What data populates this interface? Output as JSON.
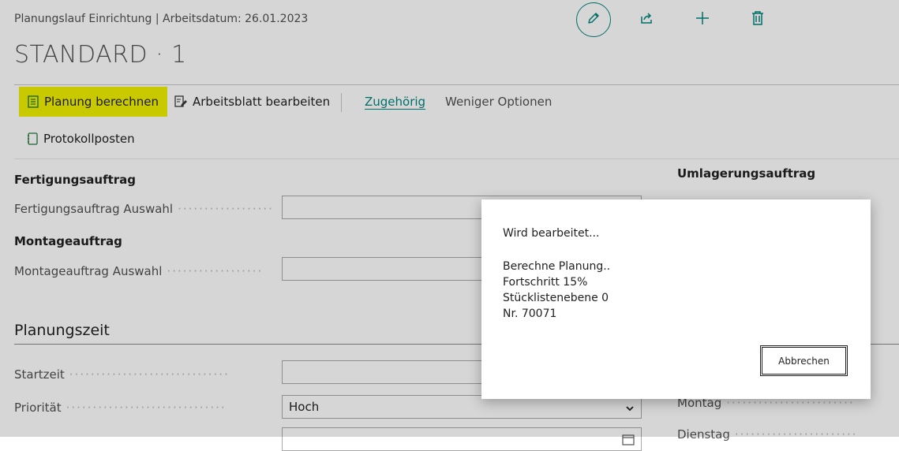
{
  "header": {
    "breadcrumb": "Planungslauf Einrichtung | Arbeitsdatum: 26.01.2023",
    "title": "STANDARD · 1",
    "icons": [
      "edit-icon",
      "share-icon",
      "add-icon",
      "delete-icon"
    ],
    "accent_color": "#00857e"
  },
  "actions": {
    "planung_berechnen": "Planung berechnen",
    "arbeitsblatt_bearbeiten": "Arbeitsblatt bearbeiten",
    "zugehoerig": "Zugehörig",
    "weniger_optionen": "Weniger Optionen",
    "protokollposten": "Protokollposten",
    "highlight_color": "#f0f000"
  },
  "form": {
    "fertigungsauftrag_caption": "Fertigungsauftrag",
    "fertigungsauftrag_auswahl_label": "Fertigungsauftrag Auswahl",
    "montageauftrag_caption": "Montageauftrag",
    "montageauftrag_auswahl_label": "Montageauftrag Auswahl",
    "umlagerungsauftrag_caption": "Umlagerungsauftrag",
    "planungszeit_title": "Planungszeit",
    "startzeit_label": "Startzeit",
    "prioritaet_label": "Priorität",
    "prioritaet_value": "Hoch",
    "montag_label": "Montag",
    "dienstag_label": "Dienstag"
  },
  "dialog": {
    "title": "Wird bearbeitet...",
    "line1": "Berechne Planung..",
    "line2": "Fortschritt 15%",
    "line3": "Stücklistenebene 0",
    "line4": "Nr. 70071",
    "cancel_label": "Abbrechen"
  }
}
